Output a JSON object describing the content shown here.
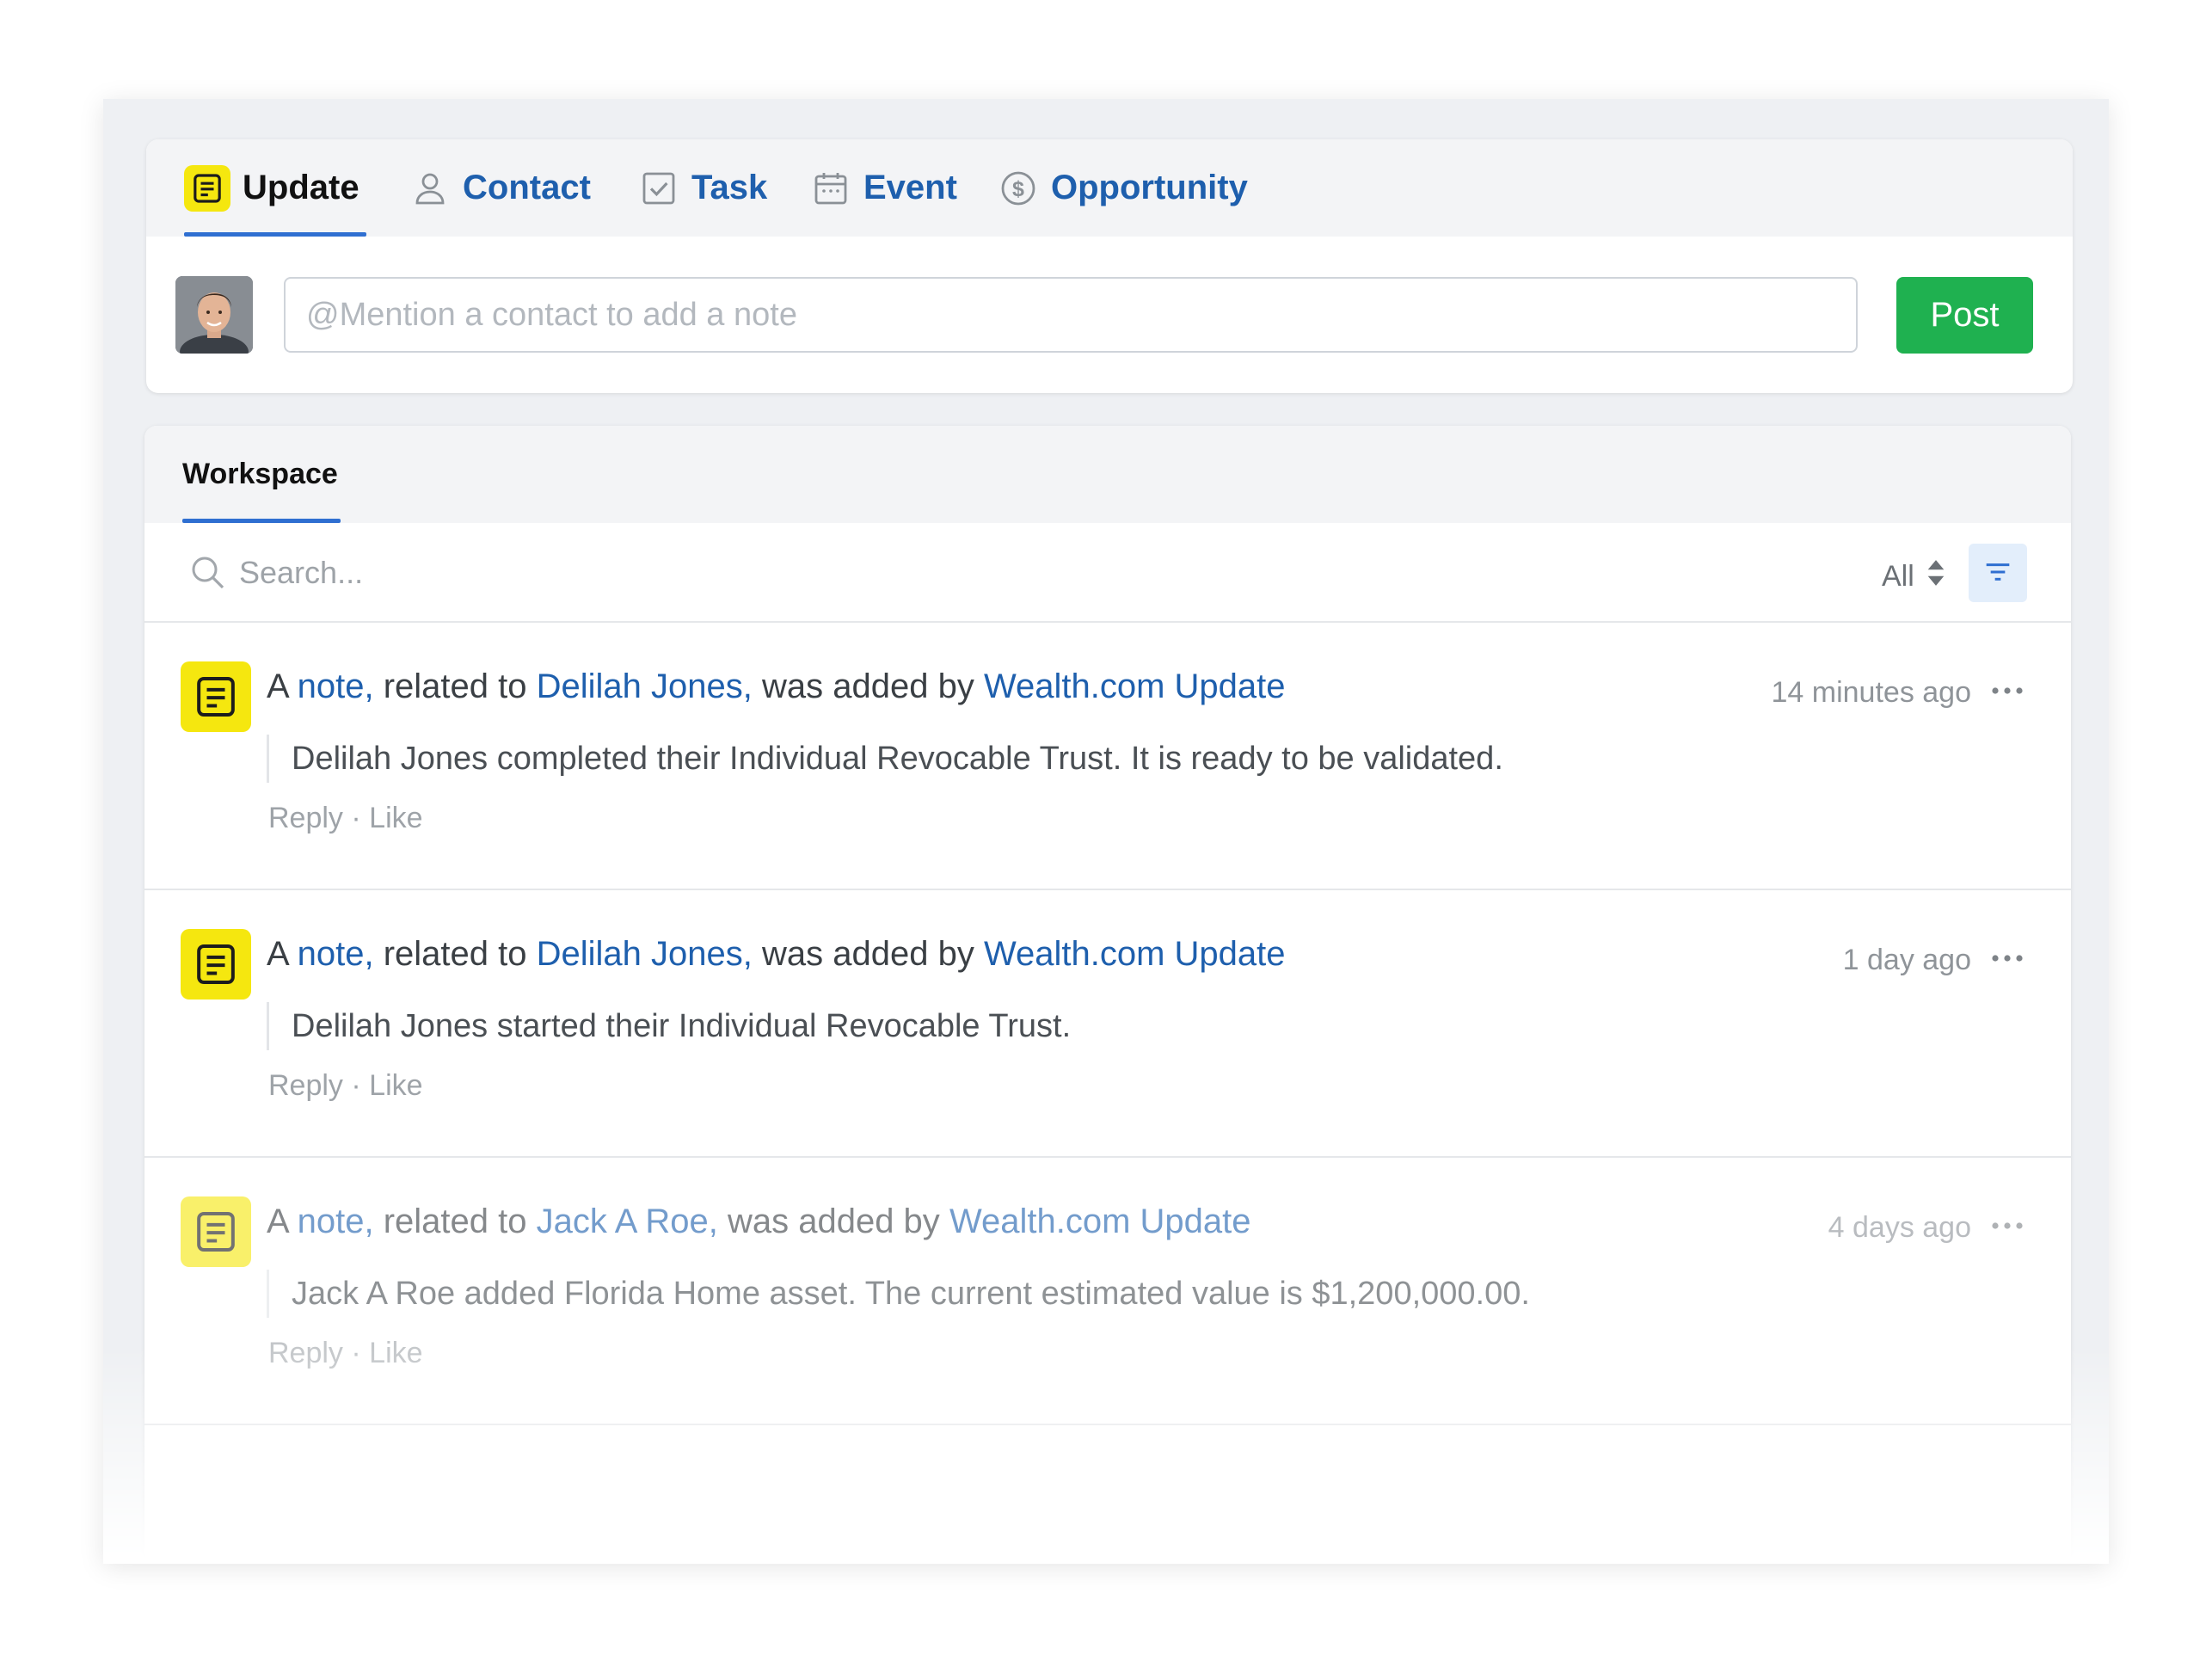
{
  "composer": {
    "tabs": [
      {
        "label": "Update",
        "icon": "note-icon",
        "active": true
      },
      {
        "label": "Contact",
        "icon": "person-icon",
        "active": false
      },
      {
        "label": "Task",
        "icon": "checkbox-icon",
        "active": false
      },
      {
        "label": "Event",
        "icon": "calendar-icon",
        "active": false
      },
      {
        "label": "Opportunity",
        "icon": "dollar-circle-icon",
        "active": false
      }
    ],
    "input_placeholder": "@Mention a contact to add a note",
    "post_label": "Post"
  },
  "workspace": {
    "tab_label": "Workspace",
    "search_placeholder": "Search...",
    "filter_value": "All",
    "items": [
      {
        "prefix": "A",
        "note_link": "note,",
        "related_text": "related to",
        "contact_link": "Delilah Jones,",
        "added_text": "was added by",
        "author_link": "Wealth.com Update",
        "timestamp": "14 minutes ago",
        "body": "Delilah Jones completed their Individual Revocable Trust. It is ready to be validated.",
        "reply_label": "Reply",
        "separator": "·",
        "like_label": "Like"
      },
      {
        "prefix": "A",
        "note_link": "note,",
        "related_text": "related to",
        "contact_link": "Delilah Jones,",
        "added_text": "was added by",
        "author_link": "Wealth.com Update",
        "timestamp": "1 day ago",
        "body": "Delilah Jones started their Individual Revocable Trust.",
        "reply_label": "Reply",
        "separator": "·",
        "like_label": "Like"
      },
      {
        "prefix": "A",
        "note_link": "note,",
        "related_text": "related to",
        "contact_link": "Jack A Roe,",
        "added_text": "was added by",
        "author_link": "Wealth.com Update",
        "timestamp": "4 days ago",
        "body": "Jack A Roe added Florida Home asset. The current estimated value is $1,200,000.00.",
        "reply_label": "Reply",
        "separator": "·",
        "like_label": "Like"
      }
    ]
  },
  "colors": {
    "link": "#1e5fad",
    "active_tab_underline": "#2f6fd1",
    "post_button": "#1fb150",
    "note_badge": "#f5e70f"
  }
}
